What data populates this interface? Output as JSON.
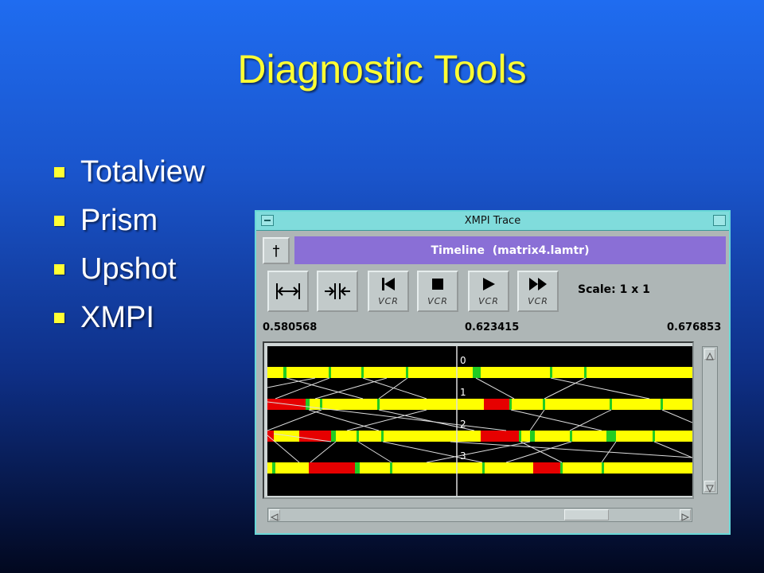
{
  "slide": {
    "title": "Diagnostic Tools",
    "bullets": [
      "Totalview",
      "Prism",
      "Upshot",
      "XMPI"
    ]
  },
  "window": {
    "title": "XMPI Trace",
    "timeline_header": "Timeline  (matrix4.lamtr)",
    "vcr_label": "VCR",
    "scale_label": "Scale: 1 x 1",
    "time_start": "0.580568",
    "time_mid": "0.623415",
    "time_end": "0.676853",
    "rank_labels": [
      "0",
      "1",
      "2",
      "3"
    ],
    "colors": {
      "running": "#ffff00",
      "blocked": "#e60000",
      "message_event": "#22cc22",
      "background": "#000000",
      "cursor": "#dddddd"
    },
    "hscroll_position": 0.72
  }
}
